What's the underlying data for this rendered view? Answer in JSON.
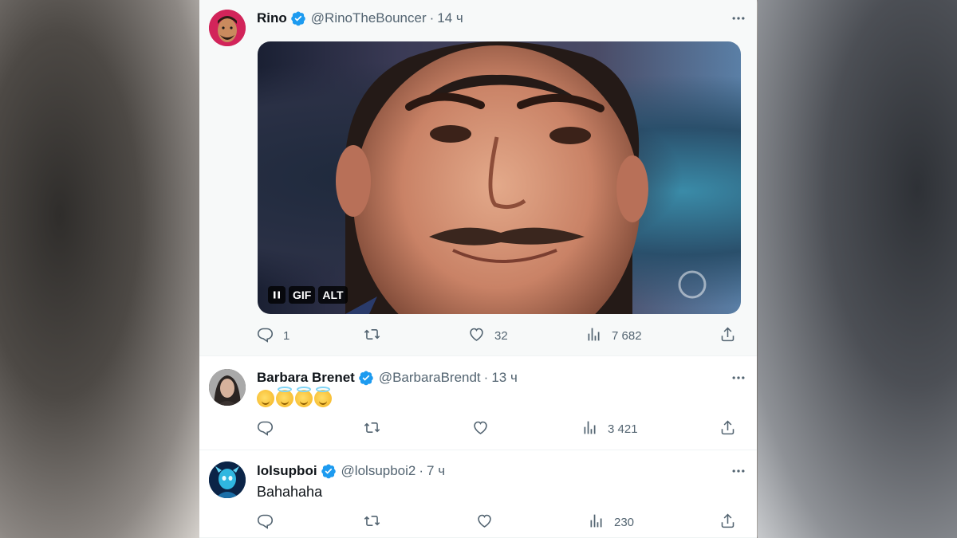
{
  "tweets": [
    {
      "name": "Rino",
      "handle": "@RinoTheBouncer",
      "dot": "·",
      "time": "14 ч",
      "media": {
        "badges": [
          "GIF",
          "ALT"
        ]
      },
      "replies": "1",
      "retweets": "",
      "likes": "32",
      "views": "7 682"
    },
    {
      "name": "Barbara Brenet",
      "handle": "@BarbaraBrendt",
      "dot": "·",
      "time": "13 ч",
      "text_emoji": [
        "winking-face",
        "smiling-face-with-halo",
        "smiling-face-with-halo",
        "smiling-face-with-halo"
      ],
      "replies": "",
      "retweets": "",
      "likes": "",
      "views": "3 421"
    },
    {
      "name": "lolsupboi",
      "handle": "@lolsupboi2",
      "dot": "·",
      "time": "7 ч",
      "text": "Bahahaha",
      "replies": "",
      "retweets": "",
      "likes": "",
      "views": "230"
    }
  ],
  "colors": {
    "verified": "#1d9bf0",
    "secondary_text": "#536471",
    "primary_text": "#0f1419"
  },
  "icons": {
    "reply": "reply-icon",
    "retweet": "retweet-icon",
    "like": "heart-icon",
    "views": "views-chart-icon",
    "share": "share-icon",
    "more": "more-icon",
    "verified": "verified-badge-icon",
    "pause": "pause-icon"
  }
}
